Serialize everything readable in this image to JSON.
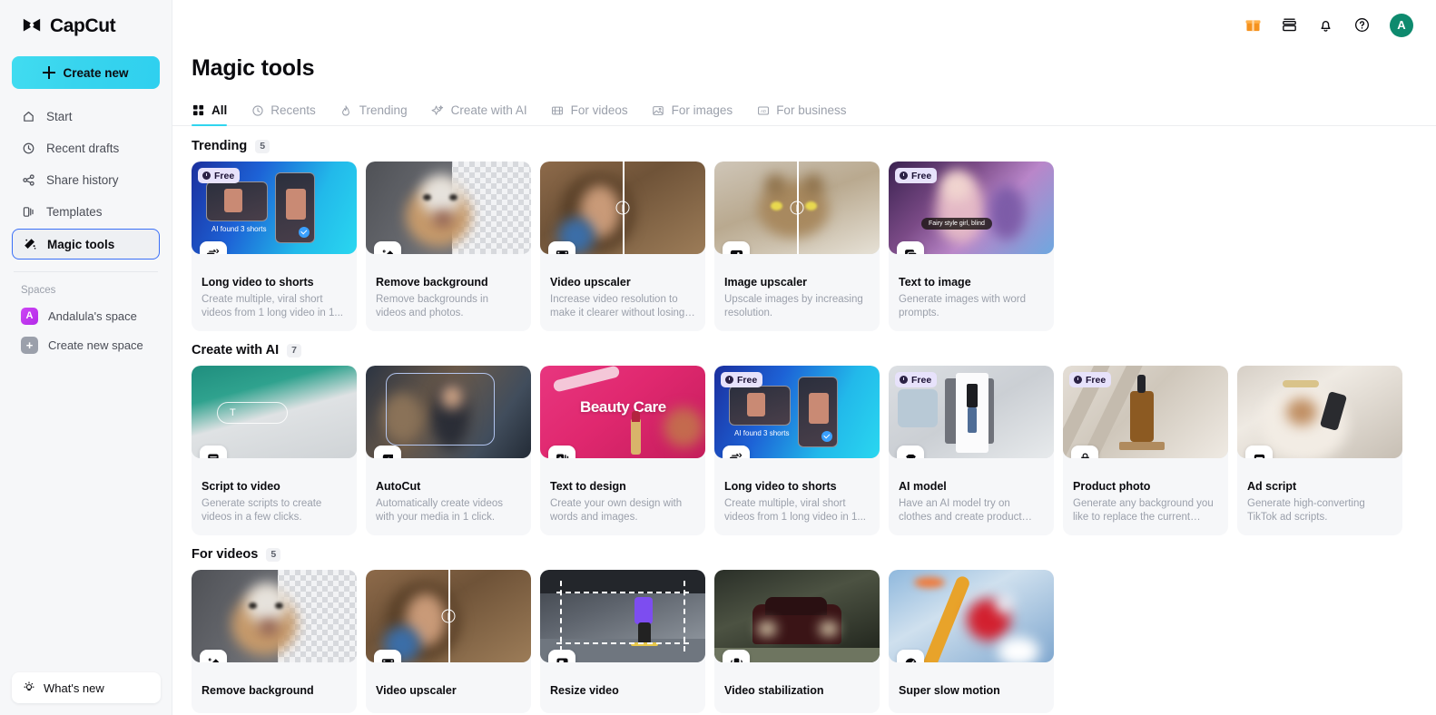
{
  "brand": {
    "name": "CapCut"
  },
  "sidebar": {
    "create_new_label": "Create new",
    "items": [
      {
        "label": "Start",
        "icon": "home-icon"
      },
      {
        "label": "Recent drafts",
        "icon": "clock-icon"
      },
      {
        "label": "Share history",
        "icon": "share-icon"
      },
      {
        "label": "Templates",
        "icon": "templates-icon"
      },
      {
        "label": "Magic tools",
        "icon": "magic-wand-icon",
        "active": true
      }
    ],
    "spaces_label": "Spaces",
    "spaces": [
      {
        "label": "Andalula's space",
        "avatar": "A",
        "color": "#c13bf0"
      },
      {
        "label": "Create new space",
        "avatar": "+",
        "color": "#9ba0ab"
      }
    ],
    "whats_new_label": "What's new"
  },
  "topbar": {
    "icons": [
      "gift-icon",
      "inbox-icon",
      "bell-icon",
      "help-icon"
    ],
    "avatar_initial": "A",
    "avatar_color": "#0e8a6e"
  },
  "header": {
    "title": "Magic tools"
  },
  "tabs": [
    {
      "label": "All",
      "icon": "grid-icon",
      "active": true
    },
    {
      "label": "Recents",
      "icon": "clock-icon",
      "active": false
    },
    {
      "label": "Trending",
      "icon": "flame-icon",
      "active": false
    },
    {
      "label": "Create with AI",
      "icon": "sparkle-icon",
      "active": false
    },
    {
      "label": "For videos",
      "icon": "film-icon",
      "active": false
    },
    {
      "label": "For images",
      "icon": "image-icon",
      "active": false
    },
    {
      "label": "For business",
      "icon": "business-icon",
      "active": false
    }
  ],
  "sections": [
    {
      "title": "Trending",
      "count": "5",
      "cards": [
        {
          "title": "Long video to shorts",
          "desc": "Create multiple, viral short videos from 1 long video in 1...",
          "badge": "Free",
          "icon": "long-video-to-shorts-icon",
          "art": "a-shorts"
        },
        {
          "title": "Remove background",
          "desc": "Remove backgrounds in videos and photos.",
          "badge": "",
          "icon": "magic-eraser-icon",
          "art": "a-dogL"
        },
        {
          "title": "Video upscaler",
          "desc": "Increase video resolution to make it clearer without losing i...",
          "badge": "",
          "icon": "video-upscaler-2x-icon",
          "art": "a-curly"
        },
        {
          "title": "Image upscaler",
          "desc": "Upscale images by increasing resolution.",
          "badge": "",
          "icon": "image-upscaler-4k-icon",
          "art": "a-cat"
        },
        {
          "title": "Text to image",
          "desc": "Generate images with word prompts.",
          "badge": "Free",
          "icon": "text-to-image-icon",
          "art": "a-fairy"
        }
      ]
    },
    {
      "title": "Create with AI",
      "count": "7",
      "cards": [
        {
          "title": "Script to video",
          "desc": "Generate scripts to create videos in a few clicks.",
          "badge": "",
          "icon": "script-to-video-icon",
          "art": "a-script"
        },
        {
          "title": "AutoCut",
          "desc": "Automatically create videos with your media in 1 click.",
          "badge": "",
          "icon": "autocut-icon",
          "art": "a-autocut"
        },
        {
          "title": "Text to design",
          "desc": "Create your own design with words and images.",
          "badge": "",
          "icon": "text-to-design-icon",
          "art": "a-beauty"
        },
        {
          "title": "Long video to shorts",
          "desc": "Create multiple, viral short videos from 1 long video in 1...",
          "badge": "Free",
          "icon": "long-video-to-shorts-icon",
          "art": "a-shorts"
        },
        {
          "title": "AI model",
          "desc": "Have an AI model try on clothes and create product images.",
          "badge": "Free",
          "icon": "ai-model-icon",
          "art": "a-model"
        },
        {
          "title": "Product photo",
          "desc": "Generate any background you like to replace the current one...",
          "badge": "Free",
          "icon": "product-photo-icon",
          "art": "a-bottle"
        },
        {
          "title": "Ad script",
          "desc": "Generate high-converting TikTok ad scripts.",
          "badge": "",
          "icon": "ad-script-icon",
          "art": "a-adsc"
        }
      ]
    },
    {
      "title": "For videos",
      "count": "5",
      "cards": [
        {
          "title": "Remove background",
          "desc": "",
          "badge": "",
          "icon": "magic-eraser-icon",
          "art": "a-dogL"
        },
        {
          "title": "Video upscaler",
          "desc": "",
          "badge": "",
          "icon": "video-upscaler-2x-icon",
          "art": "a-curly"
        },
        {
          "title": "Resize video",
          "desc": "",
          "badge": "",
          "icon": "resize-video-icon",
          "art": "a-skate"
        },
        {
          "title": "Video stabilization",
          "desc": "",
          "badge": "",
          "icon": "video-stabilization-icon",
          "art": "a-car"
        },
        {
          "title": "Super slow motion",
          "desc": "",
          "badge": "",
          "icon": "slow-motion-05x-icon",
          "art": "a-snow"
        }
      ]
    }
  ],
  "artwork": {
    "shorts_caption": "AI found 3 shorts",
    "fairy_prompt": "Fairy style girl, blind",
    "beauty_text": "Beauty Care"
  }
}
